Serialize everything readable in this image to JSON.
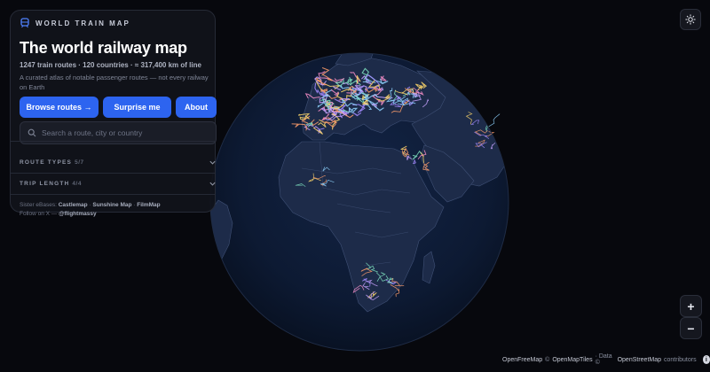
{
  "app": {
    "brand": "WORLD TRAIN MAP",
    "title": "The world railway map",
    "stats": "1247 train routes · 120 countries · ≈ 317,400 km of line",
    "description": "A curated atlas of notable passenger routes — not every railway on Earth"
  },
  "actions": {
    "browse": "Browse routes →",
    "surprise": "Surprise me",
    "about": "About"
  },
  "search": {
    "placeholder": "Search a route, city or country",
    "value": ""
  },
  "filters": [
    {
      "label": "ROUTE TYPES",
      "count": "5/7"
    },
    {
      "label": "TRIP LENGTH",
      "count": "4/4"
    }
  ],
  "footer": {
    "sister_prefix": "Sister eBases:",
    "sister_sites": [
      "Castlemap",
      "Sunshine Map",
      "FilmMap"
    ],
    "follow_prefix": "Follow on X —",
    "handle": "@flightmassy"
  },
  "map_controls": {
    "zoom_in": "+",
    "zoom_out": "−",
    "theme_icon": "sun-icon"
  },
  "attribution": {
    "openfreemap": "OpenFreeMap",
    "copy1": "©",
    "openmaptiles": "OpenMapTiles",
    "data": "· Data ©",
    "openstreetmap": "OpenStreetMap",
    "contributors": "contributors",
    "info": "i"
  },
  "colors": {
    "background": "#07080d",
    "globe_ocean": "#0e1a30",
    "land": "#1d2b49",
    "border": "#4b5d82",
    "accent": "#2d64f0",
    "routes": [
      "#c9a3ff",
      "#8fd3ff",
      "#ffd86b",
      "#ff9e6b",
      "#7fe3c0",
      "#a58bff",
      "#f28cc5"
    ]
  }
}
